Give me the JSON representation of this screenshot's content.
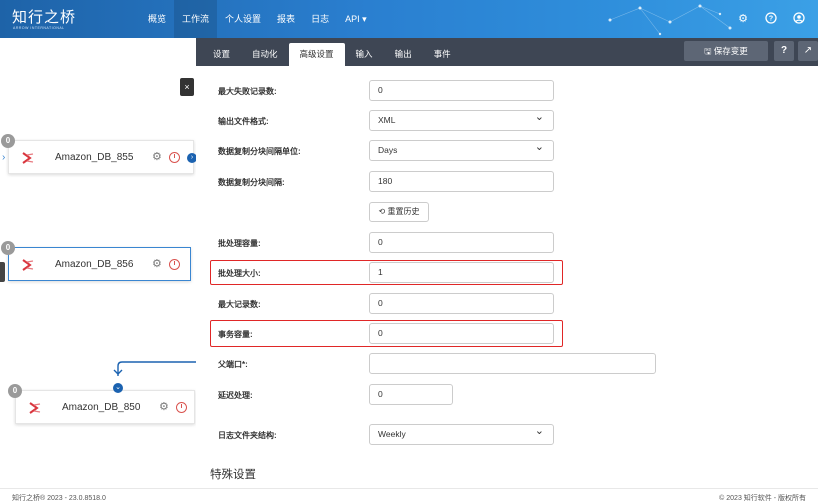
{
  "app": {
    "logo_text": "知行之桥",
    "logo_sub": "ARROW INTERNATIONAL"
  },
  "nav": {
    "items": [
      {
        "label": "概览"
      },
      {
        "label": "工作流",
        "active": true
      },
      {
        "label": "个人设置"
      },
      {
        "label": "报表"
      },
      {
        "label": "日志"
      },
      {
        "label": "API ▾"
      }
    ]
  },
  "top_icons": [
    "gear-icon",
    "help-icon",
    "user-icon"
  ],
  "canvas": {
    "close_label": "×",
    "nodes": [
      {
        "name": "Amazon_DB_855",
        "badge": "0"
      },
      {
        "name": "Amazon_DB_856",
        "badge": "0"
      },
      {
        "name": "Amazon_DB_850",
        "badge": "0"
      }
    ]
  },
  "panel": {
    "tabs": [
      "设置",
      "自动化",
      "高级设置",
      "输入",
      "输出",
      "事件"
    ],
    "active_tab": "高级设置",
    "save_label": "🖫 保存变更",
    "help_label": "?",
    "external_label": "↗",
    "fields": {
      "max_failed_records": {
        "label": "最大失败记录数:",
        "value": "0"
      },
      "output_file_format": {
        "label": "输出文件格式:",
        "value": "XML"
      },
      "chunk_interval_unit": {
        "label": "数据复制分块间隔单位:",
        "value": "Days"
      },
      "chunk_interval": {
        "label": "数据复制分块间隔:",
        "value": "180"
      },
      "reset_history": {
        "label": "⟲ 重置历史"
      },
      "batch_capacity": {
        "label": "批处理容量:",
        "value": "0"
      },
      "batch_size": {
        "label": "批处理大小:",
        "value": "1"
      },
      "max_records": {
        "label": "最大记录数:",
        "value": "0"
      },
      "transaction_capacity": {
        "label": "事务容量:",
        "value": "0"
      },
      "parent_port": {
        "label": "父端口*:",
        "value": ""
      },
      "delay_processing": {
        "label": "延迟处理:",
        "value": "0"
      },
      "log_folder_structure": {
        "label": "日志文件夹结构:",
        "value": "Weekly"
      }
    },
    "section_title": "特殊设置"
  },
  "footer": {
    "left": "知行之桥® 2023 - 23.0.8518.0",
    "right": "© 2023 知行软件 - 版权所有"
  },
  "colors": {
    "topbar": "#2a7fd0",
    "tabbar": "#3e4654",
    "highlight": "#e02727",
    "port": "#1b62b0"
  }
}
